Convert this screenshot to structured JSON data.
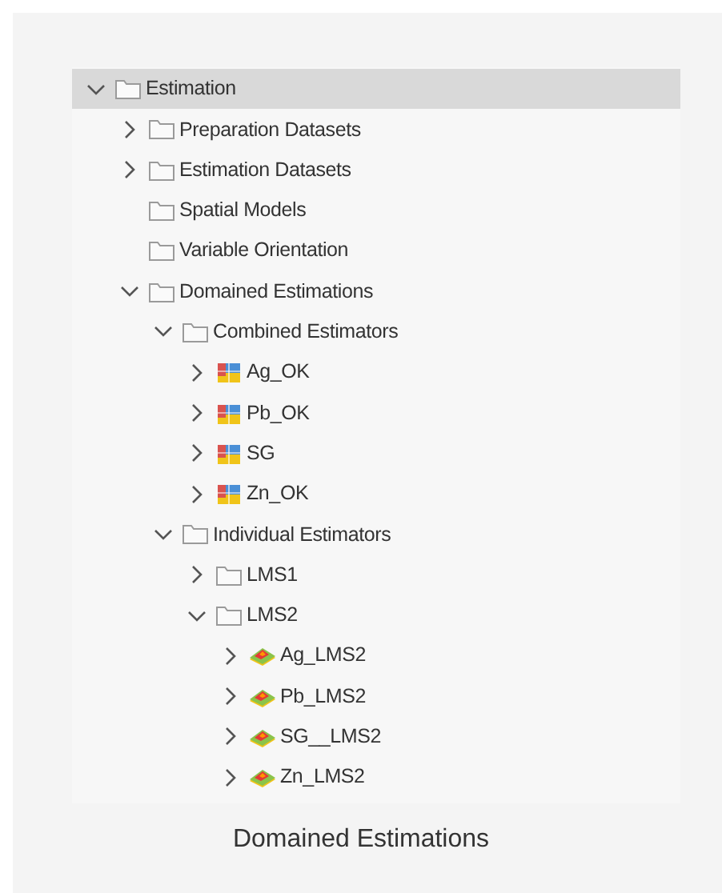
{
  "tree": [
    {
      "label": "Estimation",
      "kind": "folder",
      "expanded": true,
      "selected": true,
      "children": [
        {
          "label": "Preparation Datasets",
          "kind": "folder",
          "expanded": false,
          "selected": false
        },
        {
          "label": "Estimation Datasets",
          "kind": "folder",
          "expanded": false,
          "selected": false
        },
        {
          "label": "Spatial Models",
          "kind": "folder",
          "selected": false
        },
        {
          "label": "Variable Orientation",
          "kind": "folder",
          "selected": false
        },
        {
          "label": "Domained Estimations",
          "kind": "folder",
          "expanded": true,
          "selected": false,
          "children": [
            {
              "label": "Combined Estimators",
              "kind": "folder",
              "expanded": true,
              "selected": false,
              "children": [
                {
                  "label": "Ag_OK",
                  "kind": "block-model",
                  "expanded": false,
                  "selected": false
                },
                {
                  "label": "Pb_OK",
                  "kind": "block-model",
                  "expanded": false,
                  "selected": false
                },
                {
                  "label": "SG",
                  "kind": "block-model",
                  "expanded": false,
                  "selected": false
                },
                {
                  "label": "Zn_OK",
                  "kind": "block-model",
                  "expanded": false,
                  "selected": false
                }
              ]
            },
            {
              "label": "Individual Estimators",
              "kind": "folder",
              "expanded": true,
              "selected": false,
              "children": [
                {
                  "label": "LMS1",
                  "kind": "folder",
                  "expanded": false,
                  "selected": false
                },
                {
                  "label": "LMS2",
                  "kind": "folder",
                  "expanded": true,
                  "selected": false,
                  "children": [
                    {
                      "label": "Ag_LMS2",
                      "kind": "surface",
                      "expanded": false,
                      "selected": false
                    },
                    {
                      "label": "Pb_LMS2",
                      "kind": "surface",
                      "expanded": false,
                      "selected": false
                    },
                    {
                      "label": "SG__LMS2",
                      "kind": "surface",
                      "expanded": false,
                      "selected": false
                    },
                    {
                      "label": "Zn_LMS2",
                      "kind": "surface",
                      "expanded": false,
                      "selected": false
                    }
                  ]
                }
              ]
            }
          ]
        }
      ]
    }
  ],
  "caption": "Domained Estimations"
}
